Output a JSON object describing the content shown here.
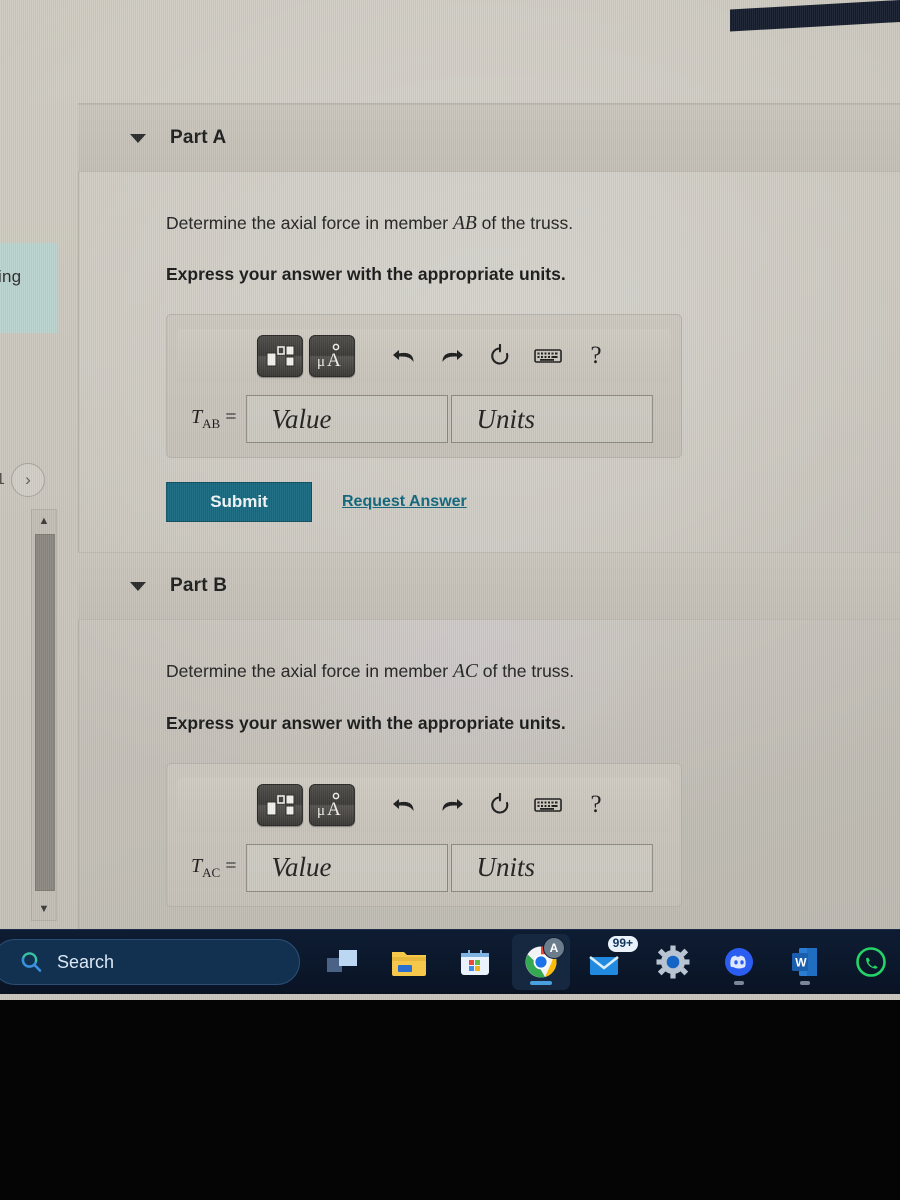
{
  "parts": [
    {
      "id": "part-a",
      "title": "Part A",
      "caret_icon": "triangle-down-icon",
      "question": "Determine the axial force in member",
      "question_var": "AB",
      "question_tail": "of the truss.",
      "instruction": "Express your answer with the appropriate units.",
      "answer": {
        "label_base": "T",
        "label_sub": "AB",
        "label_equals": "=",
        "value_placeholder": "Value",
        "units_placeholder": "Units",
        "value_text": "",
        "units_text": ""
      },
      "toolbar": [
        {
          "name": "math-template-icon",
          "label": "Templates"
        },
        {
          "name": "units-micro-angstrom-icon",
          "label": "μÅ"
        },
        {
          "name": "undo-icon",
          "label": "Undo"
        },
        {
          "name": "redo-icon",
          "label": "Redo"
        },
        {
          "name": "reset-icon",
          "label": "Reset"
        },
        {
          "name": "keyboard-icon",
          "label": "Keyboard Shortcuts"
        },
        {
          "name": "help-icon",
          "label": "?"
        }
      ],
      "submit_label": "Submit",
      "request_answer_label": "Request Answer"
    },
    {
      "id": "part-b",
      "title": "Part B",
      "caret_icon": "triangle-down-icon",
      "question": "Determine the axial force in member",
      "question_var": "AC",
      "question_tail": "of the truss.",
      "instruction": "Express your answer with the appropriate units.",
      "answer": {
        "label_base": "T",
        "label_sub": "AC",
        "label_equals": "=",
        "value_placeholder": "Value",
        "units_placeholder": "Units",
        "value_text": "",
        "units_text": ""
      },
      "toolbar": [
        {
          "name": "math-template-icon",
          "label": "Templates"
        },
        {
          "name": "units-micro-angstrom-icon",
          "label": "μÅ"
        },
        {
          "name": "undo-icon",
          "label": "Undo"
        },
        {
          "name": "redo-icon",
          "label": "Redo"
        },
        {
          "name": "reset-icon",
          "label": "Reset"
        },
        {
          "name": "keyboard-icon",
          "label": "Keyboard Shortcuts"
        },
        {
          "name": "help-icon",
          "label": "?"
        }
      ]
    }
  ],
  "left_rail": {
    "highlight_text": "ing",
    "page_number": "1",
    "next_icon": "chevron-right-icon",
    "scroll_up_icon": "triangle-up-icon",
    "scroll_down_icon": "triangle-down-icon"
  },
  "taskbar": {
    "search": {
      "icon": "search-icon",
      "label": "Search",
      "placeholder": "Search"
    },
    "items": [
      {
        "name": "taskview-icon",
        "label": "Task View",
        "badge": "",
        "active": false
      },
      {
        "name": "file-explorer-icon",
        "label": "File Explorer",
        "badge": "",
        "active": false
      },
      {
        "name": "microsoft-store-icon",
        "label": "Microsoft Store",
        "badge": "",
        "active": false
      },
      {
        "name": "google-chrome-icon",
        "label": "Google Chrome",
        "badge": "A",
        "active": true
      },
      {
        "name": "mail-icon",
        "label": "Mail",
        "badge": "99+",
        "active": false
      },
      {
        "name": "settings-gear-icon",
        "label": "Settings",
        "badge": "",
        "active": false
      },
      {
        "name": "discord-icon",
        "label": "Discord",
        "badge": "",
        "active": false
      },
      {
        "name": "word-icon",
        "label": "Microsoft Word",
        "badge": "",
        "active": false
      },
      {
        "name": "whatsapp-icon",
        "label": "WhatsApp",
        "badge": "",
        "active": false
      }
    ]
  },
  "colors": {
    "submit_teal": "#16697f",
    "link_teal": "#11667c",
    "page_beige": "#c9c5bc",
    "taskbar_navy": "#0b172a",
    "rail_highlight": "#b9d3cd"
  }
}
